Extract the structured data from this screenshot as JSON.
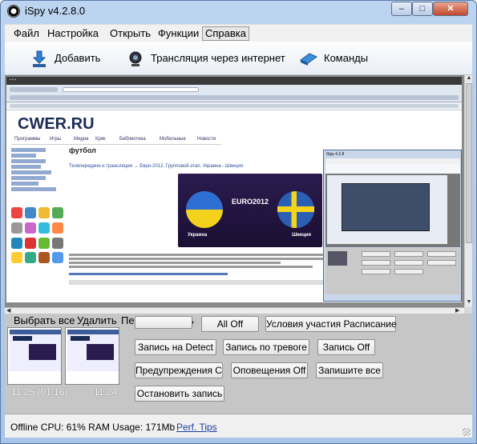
{
  "window": {
    "title": "iSpy v4.2.8.0",
    "controls": {
      "minimize": "–",
      "maximize": "□",
      "close": "✕"
    }
  },
  "menu": {
    "items": [
      "Файл",
      "Настройка",
      "Открыть",
      "Функции",
      "Справка"
    ],
    "active_index": 4
  },
  "toolbar": {
    "add_label": "Добавить",
    "add_icon": "download-arrow-icon",
    "broadcast_label": "Трансляция через интернет",
    "broadcast_icon": "webcam-icon",
    "commands_label": "Команды",
    "commands_icon": "commands-icon"
  },
  "preview": {
    "site_logo": "CWER.RU",
    "nav_items": [
      "Программы",
      "Игры",
      "Медиа",
      "Кряк",
      "Библиотека",
      "Мобильные",
      "Новости"
    ],
    "heading": "футбол",
    "breadcrumb": "Телепередачи и трансляции → Евро-2012. Групповой этап. Украина - Швеция",
    "banner_center": "EURO2012",
    "banner_left_label": "Украина",
    "banner_right_label": "Швеция",
    "inner_title": "iSpy 4.2.8"
  },
  "left_panel": {
    "select_all": "Выбрать все",
    "delete": "Удалить",
    "reload": "Перезагружать",
    "thumbnails": [
      {
        "label": "11:25 (01:16)"
      },
      {
        "label": "11:24"
      }
    ]
  },
  "actions": {
    "all_off": "All Off",
    "schedule_conditions": "Условия участия Расписание",
    "record_on_detect": "Запись на Detect",
    "record_on_alarm": "Запись по тревоге",
    "record_off": "Запись Off",
    "alerts_on": "Предупреждения С",
    "alerts_off": "Оповещения Off",
    "record_all": "Запишите все",
    "stop_recording": "Остановить запись"
  },
  "status": {
    "text": "Offline  CPU: 61% RAM Usage: 171Mb",
    "perf_tips": "Perf. Tips"
  },
  "colors": {
    "window_frame": "#a9c4e6",
    "bottom_panel": "#c6c6c6",
    "link": "#1a3fa6",
    "close_button": "#c2482b"
  }
}
